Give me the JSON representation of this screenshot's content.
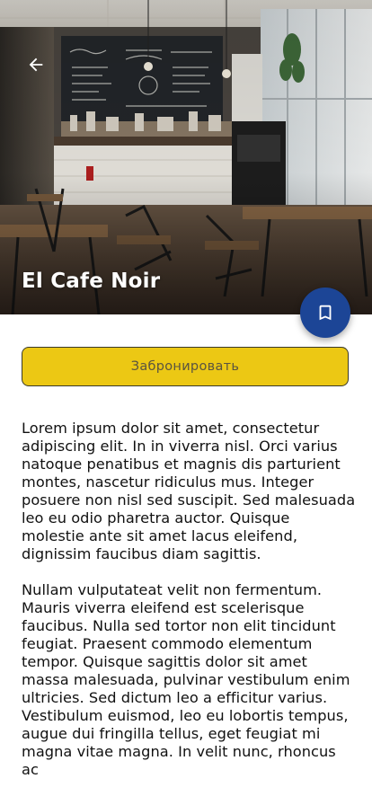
{
  "hero": {
    "title": "El Cafe Noir",
    "back_icon": "arrow-left-icon",
    "image": "cafe-interior-photo"
  },
  "fab": {
    "icon": "bookmark-icon",
    "color": "#1c4596"
  },
  "book_button": {
    "label": "Забронировать",
    "color": "#ecc814"
  },
  "description": {
    "paragraphs": [
      "Lorem ipsum dolor sit amet, consectetur adipiscing elit. In in viverra nisl. Orci varius natoque penatibus et magnis dis parturient montes, nascetur ridiculus mus. Integer posuere non nisl sed suscipit. Sed malesuada leo eu odio pharetra auctor. Quisque molestie ante sit amet lacus eleifend, dignissim faucibus diam sagittis.",
      "Nullam vulputateat velit non fermentum. Mauris viverra eleifend est scelerisque faucibus. Nulla sed tortor non elit tincidunt feugiat. Praesent commodo elementum tempor. Quisque sagittis dolor sit amet massa malesuada, pulvinar vestibulum enim ultricies. Sed dictum leo a efficitur varius. Vestibulum euismod, leo eu lobortis tempus, augue dui fringilla tellus, eget feugiat mi magna vitae magna. In velit nunc, rhoncus ac"
    ]
  }
}
